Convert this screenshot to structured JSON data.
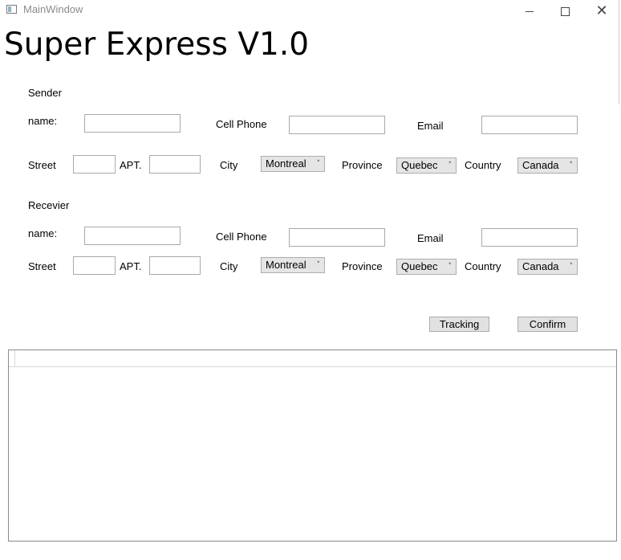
{
  "window": {
    "title": "MainWindow",
    "minimize_icon": "minimize-icon",
    "maximize_icon": "maximize-icon",
    "close_icon": "close-icon",
    "close_glyph": "✕"
  },
  "heading": "Super Express V1.0",
  "sender": {
    "section_label": "Sender",
    "name_label": "name:",
    "name_value": "",
    "phone_label": "Cell Phone",
    "phone_value": "",
    "email_label": "Email",
    "email_value": "",
    "street_label": "Street",
    "street_value": "",
    "apt_label": "APT.",
    "apt_value": "",
    "city_label": "City",
    "city_value": "Montreal",
    "province_label": "Province",
    "province_value": "Quebec",
    "country_label": "Country",
    "country_value": "Canada"
  },
  "receiver": {
    "section_label": "Recevier",
    "name_label": "name:",
    "name_value": "",
    "phone_label": "Cell Phone",
    "phone_value": "",
    "email_label": "Email",
    "email_value": "",
    "street_label": "Street",
    "street_value": "",
    "apt_label": "APT.",
    "apt_value": "",
    "city_label": "City",
    "city_value": "Montreal",
    "province_label": "Province",
    "province_value": "Quebec",
    "country_label": "Country",
    "country_value": "Canada"
  },
  "combo_chevron": "˅",
  "actions": {
    "tracking_label": "Tracking",
    "confirm_label": "Confirm"
  }
}
